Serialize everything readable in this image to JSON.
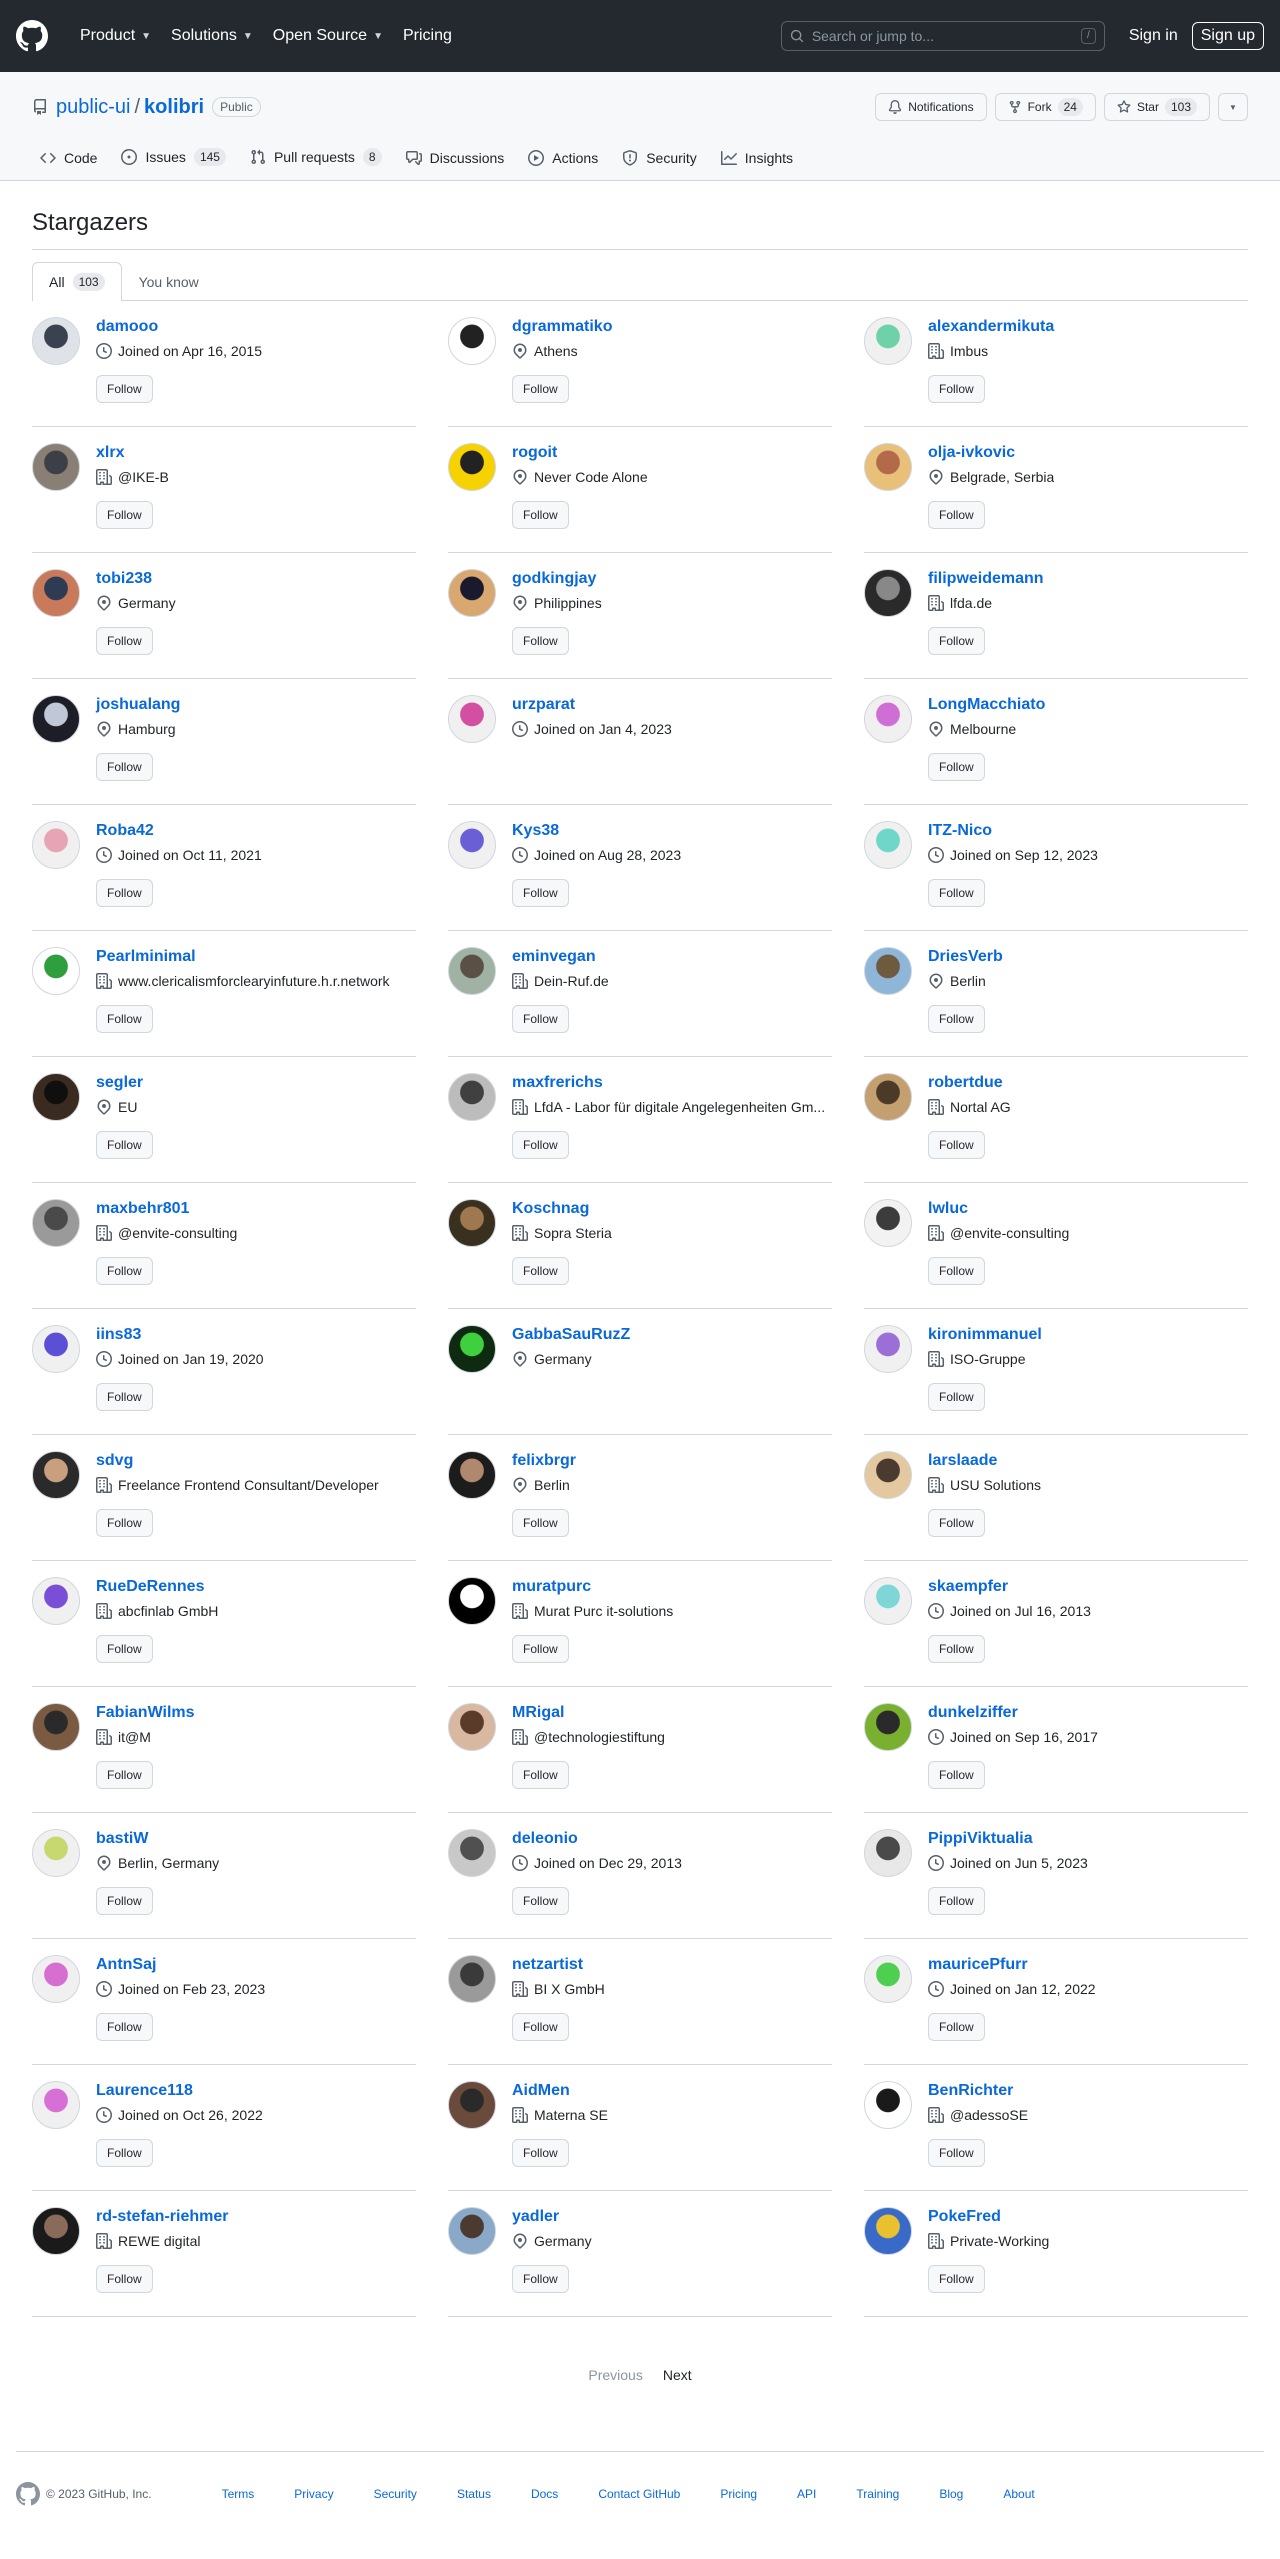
{
  "header": {
    "nav": [
      "Product",
      "Solutions",
      "Open Source",
      "Pricing"
    ],
    "search_placeholder": "Search or jump to...",
    "search_key": "/",
    "signin": "Sign in",
    "signup": "Sign up"
  },
  "repo": {
    "owner": "public-ui",
    "separator": "/",
    "name": "kolibri",
    "visibility": "Public",
    "notifications": "Notifications",
    "fork_label": "Fork",
    "fork_count": "24",
    "star_label": "Star",
    "star_count": "103",
    "tabs": [
      {
        "label": "Code",
        "icon": "code-icon",
        "count": ""
      },
      {
        "label": "Issues",
        "icon": "issue-icon",
        "count": "145"
      },
      {
        "label": "Pull requests",
        "icon": "pull-request-icon",
        "count": "8"
      },
      {
        "label": "Discussions",
        "icon": "discussion-icon",
        "count": ""
      },
      {
        "label": "Actions",
        "icon": "play-icon",
        "count": ""
      },
      {
        "label": "Security",
        "icon": "shield-icon",
        "count": ""
      },
      {
        "label": "Insights",
        "icon": "graph-icon",
        "count": ""
      }
    ]
  },
  "page": {
    "title": "Stargazers",
    "subtabs": [
      {
        "label": "All",
        "count": "103"
      },
      {
        "label": "You know",
        "count": ""
      }
    ],
    "follow_label": "Follow"
  },
  "users": [
    {
      "name": "damooo",
      "icon": "clock",
      "meta": "Joined on Apr 16, 2015",
      "colors": [
        "#dfe3e8",
        "#3a4250"
      ]
    },
    {
      "name": "dgrammatiko",
      "icon": "location",
      "meta": "Athens",
      "colors": [
        "#ffffff",
        "#222222"
      ]
    },
    {
      "name": "alexandermikuta",
      "icon": "building",
      "meta": "Imbus",
      "colors": [
        "#f0f0f0",
        "#6fd1a8"
      ]
    },
    {
      "name": "xlrx",
      "icon": "building",
      "meta": "@IKE-B",
      "colors": [
        "#8a7f74",
        "#3c3f47"
      ]
    },
    {
      "name": "rogoit",
      "icon": "location",
      "meta": "Never Code Alone",
      "colors": [
        "#f6d200",
        "#222222"
      ]
    },
    {
      "name": "olja-ivkovic",
      "icon": "location",
      "meta": "Belgrade, Serbia",
      "colors": [
        "#e8c07a",
        "#b26a4a"
      ]
    },
    {
      "name": "tobi238",
      "icon": "location",
      "meta": "Germany",
      "colors": [
        "#c97a5b",
        "#2e3b52"
      ]
    },
    {
      "name": "godkingjay",
      "icon": "location",
      "meta": "Philippines",
      "colors": [
        "#d9a870",
        "#1a1a2e"
      ]
    },
    {
      "name": "filipweidemann",
      "icon": "building",
      "meta": "lfda.de",
      "colors": [
        "#2a2a2a",
        "#888888"
      ]
    },
    {
      "name": "joshualang",
      "icon": "location",
      "meta": "Hamburg",
      "colors": [
        "#1d1d28",
        "#c0c8d8"
      ]
    },
    {
      "name": "urzparat",
      "icon": "clock",
      "meta": "Joined on Jan 4, 2023",
      "colors": [
        "#f0f0f0",
        "#d24fa2"
      ]
    },
    {
      "name": "LongMacchiato",
      "icon": "location",
      "meta": "Melbourne",
      "colors": [
        "#f0f0f0",
        "#cf6fd6"
      ]
    },
    {
      "name": "Roba42",
      "icon": "clock",
      "meta": "Joined on Oct 11, 2021",
      "colors": [
        "#f0f0f0",
        "#e6a4b4"
      ]
    },
    {
      "name": "Kys38",
      "icon": "clock",
      "meta": "Joined on Aug 28, 2023",
      "colors": [
        "#f0f0f0",
        "#6b5fd6"
      ]
    },
    {
      "name": "ITZ-Nico",
      "icon": "clock",
      "meta": "Joined on Sep 12, 2023",
      "colors": [
        "#f0f0f0",
        "#6fd6c9"
      ]
    },
    {
      "name": "Pearlminimal",
      "icon": "building",
      "meta": "www.clericalismforclearyinfuture.h.r.network",
      "colors": [
        "#ffffff",
        "#2e9e3e"
      ]
    },
    {
      "name": "eminvegan",
      "icon": "building",
      "meta": "Dein-Ruf.de",
      "colors": [
        "#9fb2a4",
        "#5a5046"
      ]
    },
    {
      "name": "DriesVerb",
      "icon": "location",
      "meta": "Berlin",
      "colors": [
        "#8fb6d8",
        "#6e5a3c"
      ]
    },
    {
      "name": "segler",
      "icon": "location",
      "meta": "EU",
      "colors": [
        "#3b2a20",
        "#0f0f0f"
      ]
    },
    {
      "name": "maxfrerichs",
      "icon": "building",
      "meta": "LfdA - Labor für digitale Angelegenheiten Gm...",
      "colors": [
        "#bcbcbc",
        "#404040"
      ]
    },
    {
      "name": "robertdue",
      "icon": "building",
      "meta": "Nortal AG",
      "colors": [
        "#c4a070",
        "#4c3a28"
      ]
    },
    {
      "name": "maxbehr801",
      "icon": "building",
      "meta": "@envite-consulting",
      "colors": [
        "#9a9a9a",
        "#4a4a4a"
      ]
    },
    {
      "name": "Koschnag",
      "icon": "building",
      "meta": "Sopra Steria",
      "colors": [
        "#3a3020",
        "#a07850"
      ]
    },
    {
      "name": "lwluc",
      "icon": "building",
      "meta": "@envite-consulting",
      "colors": [
        "#f2f2f2",
        "#3c3c3c"
      ]
    },
    {
      "name": "iins83",
      "icon": "clock",
      "meta": "Joined on Jan 19, 2020",
      "colors": [
        "#f0f0f0",
        "#5b4fd6"
      ]
    },
    {
      "name": "GabbaSauRuzZ",
      "icon": "location",
      "meta": "Germany",
      "colors": [
        "#0e2a10",
        "#3fcf3f"
      ]
    },
    {
      "name": "kironimmanuel",
      "icon": "building",
      "meta": "ISO-Gruppe",
      "colors": [
        "#f0f0f0",
        "#9b6fd6"
      ]
    },
    {
      "name": "sdvg",
      "icon": "building",
      "meta": "Freelance Frontend Consultant/Developer",
      "colors": [
        "#2a2a2a",
        "#c8a080"
      ]
    },
    {
      "name": "felixbrgr",
      "icon": "location",
      "meta": "Berlin",
      "colors": [
        "#1c1c1c",
        "#b08870"
      ]
    },
    {
      "name": "larslaade",
      "icon": "building",
      "meta": "USU Solutions",
      "colors": [
        "#e4c8a0",
        "#4a3a30"
      ]
    },
    {
      "name": "RueDeRennes",
      "icon": "building",
      "meta": "abcfinlab GmbH",
      "colors": [
        "#f0f0f0",
        "#7a4fd6"
      ]
    },
    {
      "name": "muratpurc",
      "icon": "building",
      "meta": "Murat Purc it-solutions",
      "colors": [
        "#000000",
        "#ffffff"
      ]
    },
    {
      "name": "skaempfer",
      "icon": "clock",
      "meta": "Joined on Jul 16, 2013",
      "colors": [
        "#f0f0f0",
        "#7fd6d6"
      ]
    },
    {
      "name": "FabianWilms",
      "icon": "building",
      "meta": "it@M",
      "colors": [
        "#7a5a40",
        "#2a2a2a"
      ]
    },
    {
      "name": "MRigal",
      "icon": "building",
      "meta": "@technologiestiftung",
      "colors": [
        "#d8b8a0",
        "#5a3a28"
      ]
    },
    {
      "name": "dunkelziffer",
      "icon": "clock",
      "meta": "Joined on Sep 16, 2017",
      "colors": [
        "#7ab030",
        "#2a2a2a"
      ]
    },
    {
      "name": "bastiW",
      "icon": "location",
      "meta": "Berlin, Germany",
      "colors": [
        "#f0f0f0",
        "#c8d870"
      ]
    },
    {
      "name": "deleonio",
      "icon": "clock",
      "meta": "Joined on Dec 29, 2013",
      "colors": [
        "#c8c8c8",
        "#505050"
      ]
    },
    {
      "name": "PippiViktualia",
      "icon": "clock",
      "meta": "Joined on Jun 5, 2023",
      "colors": [
        "#e8e8e8",
        "#4a4a4a"
      ]
    },
    {
      "name": "AntnSaj",
      "icon": "clock",
      "meta": "Joined on Feb 23, 2023",
      "colors": [
        "#f0f0f0",
        "#d66fd0"
      ]
    },
    {
      "name": "netzartist",
      "icon": "building",
      "meta": "BI X GmbH",
      "colors": [
        "#9a9a9a",
        "#3a3a3a"
      ]
    },
    {
      "name": "mauricePfurr",
      "icon": "clock",
      "meta": "Joined on Jan 12, 2022",
      "colors": [
        "#f0f0f0",
        "#4fcf4f"
      ]
    },
    {
      "name": "Laurence118",
      "icon": "clock",
      "meta": "Joined on Oct 26, 2022",
      "colors": [
        "#f0f0f0",
        "#d66fd6"
      ]
    },
    {
      "name": "AidMen",
      "icon": "building",
      "meta": "Materna SE",
      "colors": [
        "#6a4a3a",
        "#2a2a2a"
      ]
    },
    {
      "name": "BenRichter",
      "icon": "building",
      "meta": "@adessoSE",
      "colors": [
        "#ffffff",
        "#1a1a1a"
      ]
    },
    {
      "name": "rd-stefan-riehmer",
      "icon": "building",
      "meta": "REWE digital",
      "colors": [
        "#1a1a1a",
        "#8a6a58"
      ]
    },
    {
      "name": "yadler",
      "icon": "location",
      "meta": "Germany",
      "colors": [
        "#8aa8c8",
        "#4a3a30"
      ]
    },
    {
      "name": "PokeFred",
      "icon": "building",
      "meta": "Private-Working",
      "colors": [
        "#3a6ac8",
        "#e8c030"
      ]
    }
  ],
  "pagination": {
    "previous": "Previous",
    "next": "Next"
  },
  "footer": {
    "copyright": "© 2023 GitHub, Inc.",
    "links": [
      "Terms",
      "Privacy",
      "Security",
      "Status",
      "Docs",
      "Contact GitHub",
      "Pricing",
      "API",
      "Training",
      "Blog",
      "About"
    ]
  }
}
